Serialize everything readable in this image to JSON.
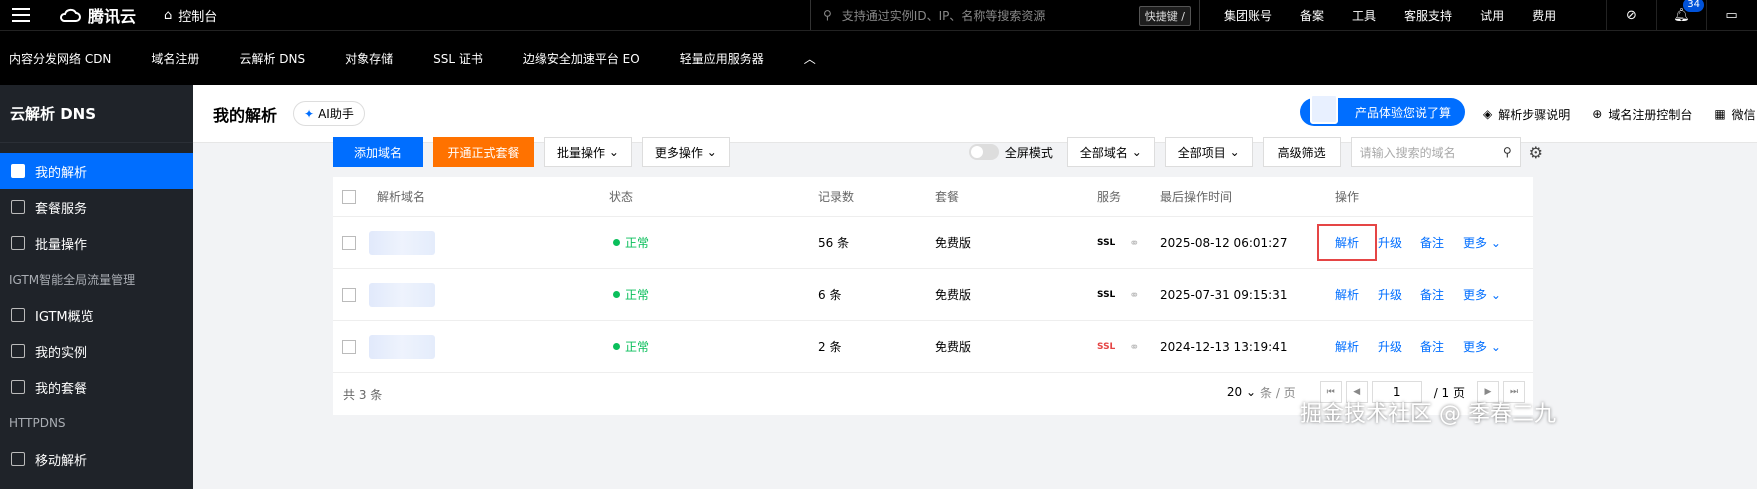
{
  "topbar": {
    "brand": "腾讯云",
    "console": "控制台",
    "search_placeholder": "支持通过实例ID、IP、名称等搜索资源",
    "shortcut": "快捷键 /",
    "nav": [
      "集团账号",
      "备案",
      "工具",
      "客服支持",
      "试用",
      "费用"
    ],
    "badge_count": "34"
  },
  "products": [
    "内容分发网络 CDN",
    "域名注册",
    "云解析 DNS",
    "对象存储",
    "SSL 证书",
    "边缘安全加速平台 EO",
    "轻量应用服务器",
    "︿"
  ],
  "sidebar": {
    "title": "云解析 DNS",
    "items": [
      "我的解析",
      "套餐服务",
      "批量操作"
    ],
    "group1": "IGTM智能全局流量管理",
    "items2": [
      "IGTM概览",
      "我的实例",
      "我的套餐"
    ],
    "group2": "HTTPDNS",
    "items3": [
      "移动解析"
    ]
  },
  "header": {
    "title": "我的解析",
    "ai": "AI助手",
    "promo": "产品体验您说了算",
    "links": [
      "解析步骤说明",
      "域名注册控制台",
      "微信"
    ]
  },
  "toolbar": {
    "add": "添加域名",
    "open": "开通正式套餐",
    "batch": "批量操作",
    "more": "更多操作",
    "fullscreen": "全屏模式",
    "all_domains": "全部域名",
    "all_projects": "全部项目",
    "advanced": "高级筛选",
    "search_placeholder": "请输入搜索的域名"
  },
  "table": {
    "columns": [
      "解析域名",
      "状态",
      "记录数",
      "套餐",
      "服务",
      "最后操作时间",
      "操作"
    ],
    "rows": [
      {
        "status": "正常",
        "records": "56 条",
        "plan": "免费版",
        "ssl": "SSL",
        "time": "2025-08-12 06:01:27",
        "ssl_warn": false
      },
      {
        "status": "正常",
        "records": "6 条",
        "plan": "免费版",
        "ssl": "SSL",
        "time": "2025-07-31 09:15:31",
        "ssl_warn": false
      },
      {
        "status": "正常",
        "records": "2 条",
        "plan": "免费版",
        "ssl": "SSL",
        "time": "2024-12-13 13:19:41",
        "ssl_warn": true
      }
    ],
    "actions": [
      "解析",
      "升级",
      "备注",
      "更多"
    ]
  },
  "footer": {
    "total": "共 3 条",
    "page_size": "20",
    "per_page": "条 / 页",
    "page": "1",
    "pages": "/ 1 页"
  },
  "watermark": "掘金技术社区 @ 季春二九",
  "colors": {
    "primary": "#006eff",
    "orange": "#ff7200",
    "success": "#0abf5b",
    "danger": "#e54545"
  }
}
